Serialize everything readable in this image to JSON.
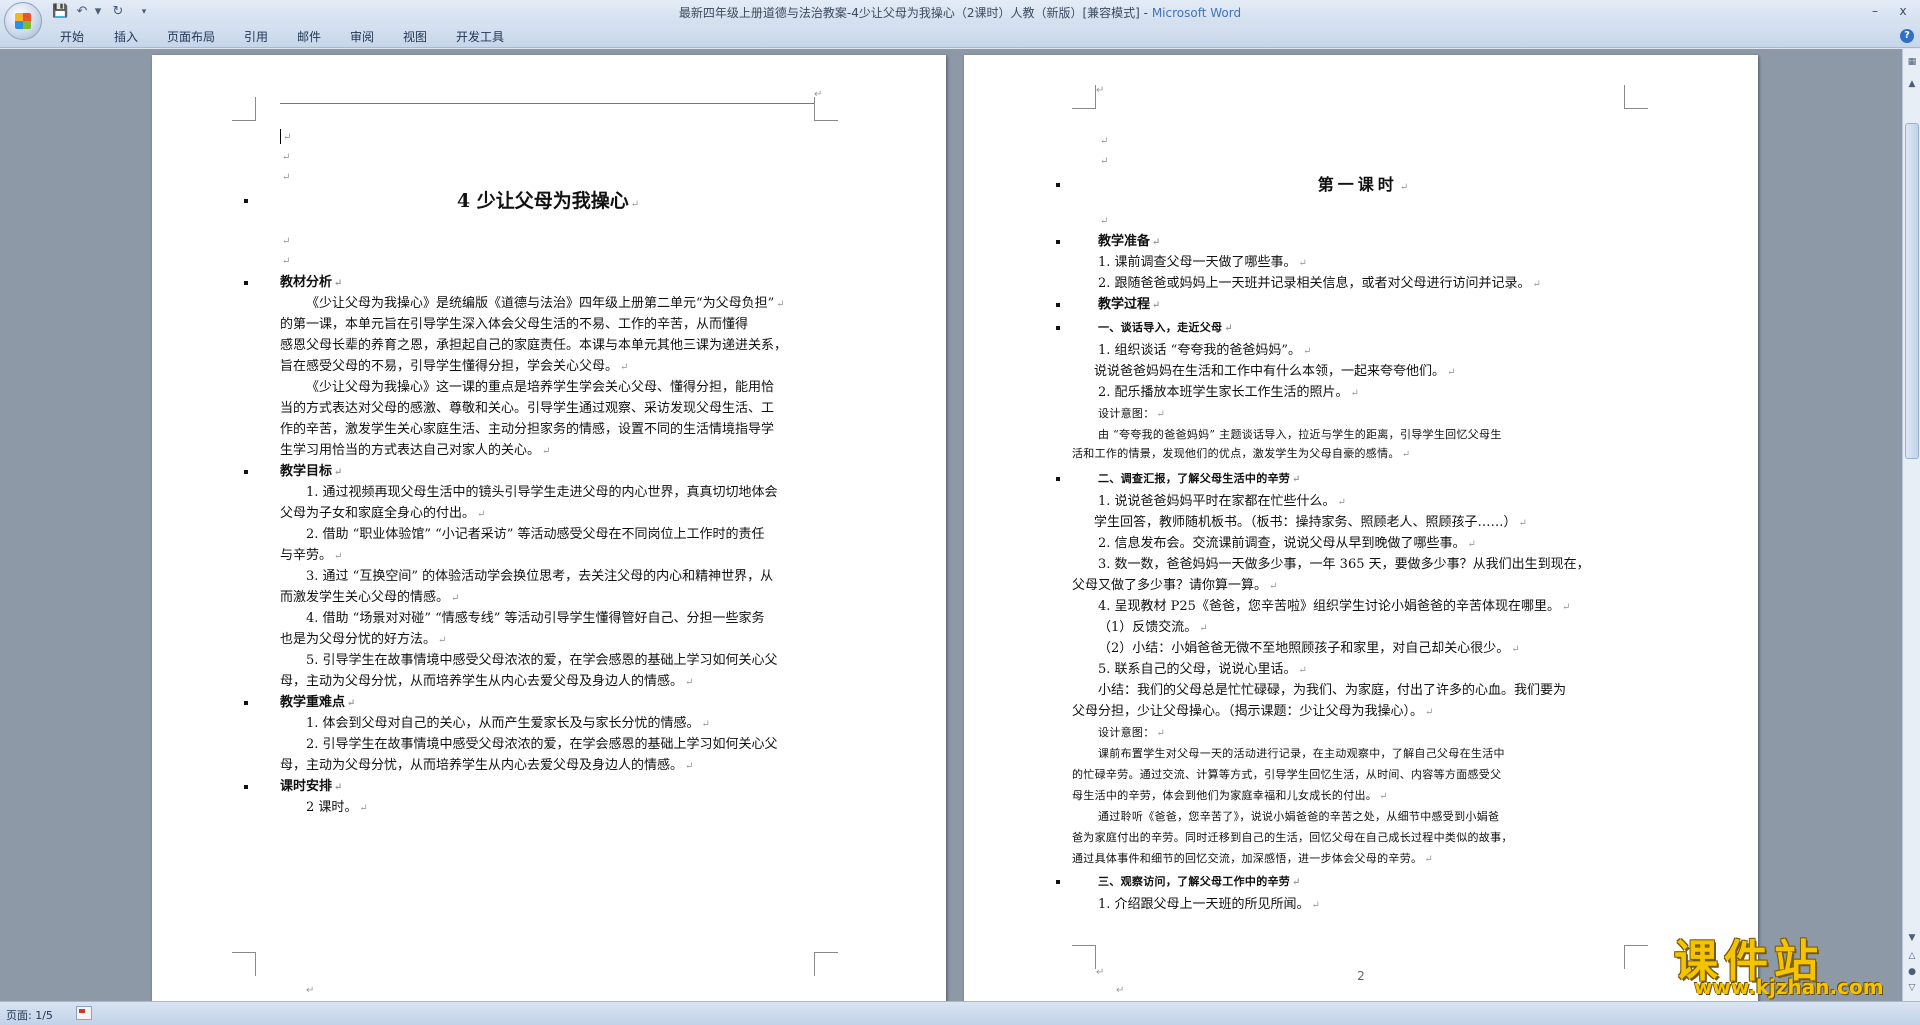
{
  "window": {
    "title": "最新四年级上册道德与法治教案-4少让父母为我操心（2课时）人教（新版）[兼容模式]",
    "app_name": "Microsoft Word",
    "minimize": "–",
    "close": "x"
  },
  "ribbon": {
    "tabs": [
      "开始",
      "插入",
      "页面布局",
      "引用",
      "邮件",
      "审阅",
      "视图",
      "开发工具"
    ],
    "help": "?"
  },
  "page1": {
    "title": "4  少让父母为我操心",
    "lines": [
      "教材分析",
      "《少让父母为我操心》是统编版《道德与法治》四年级上册第二单元“为父母负担”",
      "的第一课，本单元旨在引导学生深入体会父母生活的不易、工作的辛苦，从而懂得",
      "感恩父母长辈的养育之恩，承担起自己的家庭责任。本课与本单元其他三课为递进关系，",
      "旨在感受父母的不易，引导学生懂得分担，学会关心父母。",
      "《少让父母为我操心》这一课的重点是培养学生学会关心父母、懂得分担，能用恰",
      "当的方式表达对父母的感激、尊敬和关心。引导学生通过观察、采访发现父母生活、工",
      "作的辛苦，激发学生关心家庭生活、主动分担家务的情感，设置不同的生活情境指导学",
      "生学习用恰当的方式表达自己对家人的关心。",
      "教学目标",
      "1.  通过视频再现父母生活中的镜头引导学生走进父母的内心世界，真真切切地体会",
      "父母为子女和家庭全身心的付出。",
      "2.  借助 “职业体验馆” “小记者采访” 等活动感受父母在不同岗位上工作时的责任",
      "与辛劳。",
      "3.  通过 “互换空间” 的体验活动学会换位思考，去关注父母的内心和精神世界，从",
      "而激发学生关心父母的情感。",
      "4.  借助 “场景对对碰” “情感专线” 等活动引导学生懂得管好自己、分担一些家务",
      "也是为父母分忧的好方法。",
      "5.  引导学生在故事情境中感受父母浓浓的爱，在学会感恩的基础上学习如何关心父",
      "母，主动为父母分忧，从而培养学生从内心去爱父母及身边人的情感。",
      "教学重难点",
      "1.  体会到父母对自己的关心，从而产生爱家长及与家长分忧的情感。",
      "2.  引导学生在故事情境中感受父母浓浓的爱，在学会感恩的基础上学习如何关心父",
      "母，主动为父母分忧，从而培养学生从内心去爱父母及身边人的情感。",
      "课时安排",
      "2 课时。"
    ]
  },
  "page2": {
    "title": "第一课时",
    "lines": [
      "教学准备",
      "1.  课前调查父母一天做了哪些事。",
      "2.  跟随爸爸或妈妈上一天班并记录相关信息，或者对父母进行访问并记录。",
      "教学过程",
      "一、谈话导入，走近父母",
      "1.  组织谈话 “夸夸我的爸爸妈妈”。",
      "说说爸爸妈妈在生活和工作中有什么本领，一起来夸夸他们。",
      "2.  配乐播放本班学生家长工作生活的照片。",
      "设计意图：",
      "由 “夸夸我的爸爸妈妈” 主题谈话导入，拉近与学生的距离，引导学生回忆父母生",
      "活和工作的情景，发现他们的优点，激发学生为父母自豪的感情。",
      "二、调查汇报，了解父母生活中的辛劳",
      "1.  说说爸爸妈妈平时在家都在忙些什么。",
      "学生回答，教师随机板书。（板书：操持家务、照顾老人、照顾孩子……）",
      "2.  信息发布会。交流课前调查，说说父母从早到晚做了哪些事。",
      "3.  数一数，爸爸妈妈一天做多少事，一年 365 天，要做多少事？从我们出生到现在，",
      "父母又做了多少事？请你算一算。",
      "4.  呈现教材 P25《爸爸，您辛苦啦》组织学生讨论小娟爸爸的辛苦体现在哪里。",
      "（1）反馈交流。",
      "（2）小结：小娟爸爸无微不至地照顾孩子和家里，对自己却关心很少。",
      "5.  联系自己的父母，说说心里话。",
      "小结：我们的父母总是忙忙碌碌，为我们、为家庭，付出了许多的心血。我们要为",
      "父母分担，少让父母操心。（揭示课题：少让父母为我操心）。",
      "设计意图：",
      "课前布置学生对父母一天的活动进行记录，在主动观察中，了解自己父母在生活中",
      "的忙碌辛劳。通过交流、计算等方式，引导学生回忆生活，从时间、内容等方面感受父",
      "母生活中的辛劳，体会到他们为家庭幸福和儿女成长的付出。",
      "通过聆听《爸爸，您辛苦了》，说说小娟爸爸的辛苦之处，从细节中感受到小娟爸",
      "爸为家庭付出的辛劳。同时迁移到自己的生活，回忆父母在自己成长过程中类似的故事，",
      "通过具体事件和细节的回忆交流，加深感悟，进一步体会父母的辛劳。",
      "三、观察访问，了解父母工作中的辛劳",
      "1.  介绍跟父母上一天班的所见所闻。"
    ],
    "page_number": "2"
  },
  "status": {
    "page_info": "页面: 1/5"
  },
  "watermark": {
    "text": "课件站",
    "url": "www.kjzhan.com"
  },
  "colors": {
    "accent": "#4472b8",
    "workspace": "#8e99a8",
    "watermark": "#f5c400"
  }
}
